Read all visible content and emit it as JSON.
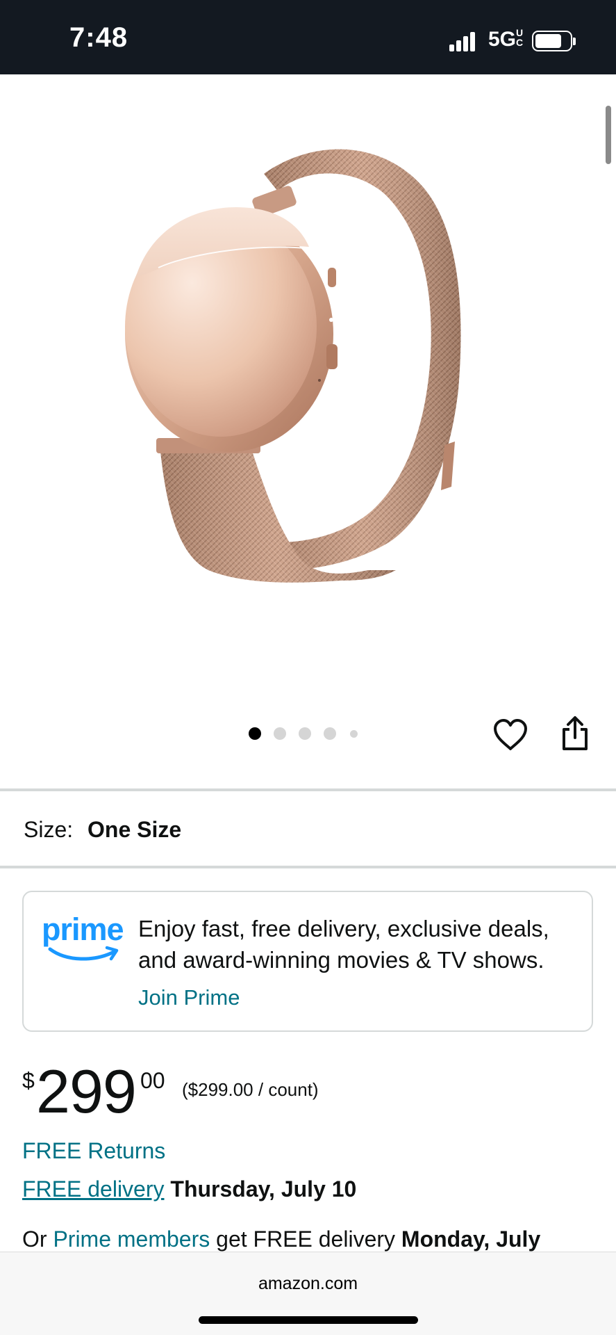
{
  "status_bar": {
    "time": "7:48",
    "network": "5G",
    "network_superscript": "UC",
    "signal_bars": 4,
    "battery_level": 0.78
  },
  "product": {
    "image_icon": "rose-gold-wearable-band",
    "gallery_dots_count": 5,
    "gallery_active_index": 0,
    "favorite_icon": "heart-icon",
    "share_icon": "share-icon"
  },
  "size": {
    "label": "Size:",
    "value": "One Size"
  },
  "prime_card": {
    "logo_text": "prime",
    "description": "Enjoy fast, free delivery, exclusive deals, and award-winning movies & TV shows.",
    "join_label": "Join Prime"
  },
  "price": {
    "symbol": "$",
    "whole": "299",
    "fraction": "00",
    "unit_price": "($299.00 / count)"
  },
  "shipping": {
    "returns": "FREE Returns",
    "delivery_link": "FREE delivery",
    "delivery_date": "Thursday, July 10",
    "prime_prefix": "Or",
    "prime_link": "Prime members",
    "prime_middle": "get FREE delivery",
    "prime_date": "Monday, July"
  },
  "browser": {
    "url": "amazon.com"
  },
  "colors": {
    "status_bar_bg": "#131921",
    "link": "#007185",
    "prime_blue": "#1a98ff",
    "text": "#0f1111"
  }
}
